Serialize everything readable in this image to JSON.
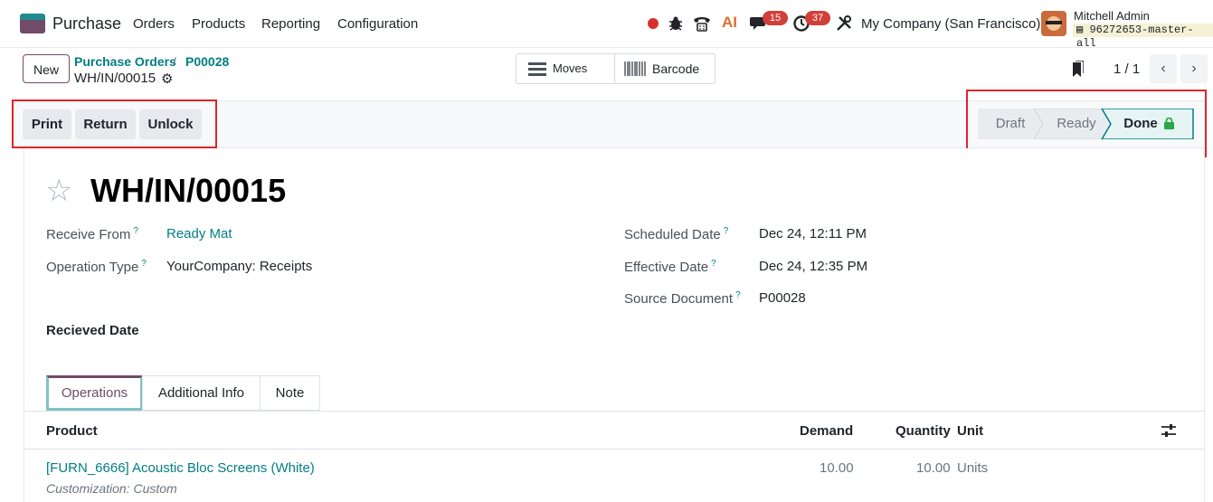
{
  "navbar": {
    "app_name": "Purchase",
    "menus": [
      "Orders",
      "Products",
      "Reporting",
      "Configuration"
    ],
    "chat_badge": "15",
    "activity_badge": "37",
    "ai_label": "AI",
    "company": "My Company (San Francisco)",
    "user_name": "Mitchell Admin",
    "db_name": "96272653-master-all"
  },
  "control": {
    "new_label": "New",
    "breadcrumb": [
      "Purchase Orders",
      "P00028"
    ],
    "breadcrumb_sep": "/",
    "current": "WH/IN/00015",
    "moves_label": "Moves",
    "barcode_label": "Barcode",
    "pager": "1 / 1",
    "prev": "‹",
    "next": "›"
  },
  "actions": {
    "print": "Print",
    "return": "Return",
    "unlock": "Unlock"
  },
  "stages": {
    "draft": "Draft",
    "ready": "Ready",
    "done": "Done",
    "active": "done"
  },
  "record": {
    "title": "WH/IN/00015",
    "left_fields": [
      {
        "label": "Receive From",
        "value": "Ready Mat"
      },
      {
        "label": "Operation Type",
        "value": "YourCompany: Receipts"
      }
    ],
    "right_fields": [
      {
        "label": "Scheduled Date",
        "value": "Dec 24, 12:11 PM"
      },
      {
        "label": "Effective Date",
        "value": "Dec 24, 12:35 PM"
      },
      {
        "label": "Source Document",
        "value": "P00028"
      }
    ],
    "help_mark": "?",
    "received_date_label": "Recieved Date"
  },
  "tabs": [
    "Operations",
    "Additional Info",
    "Note"
  ],
  "table": {
    "headers": {
      "product": "Product",
      "demand": "Demand",
      "quantity": "Quantity",
      "unit": "Unit"
    },
    "rows": [
      {
        "product": "[FURN_6666] Acoustic Bloc Screens (White)",
        "demand": "10.00",
        "quantity": "10.00",
        "unit": "Units",
        "note": "Customization: Custom"
      }
    ]
  },
  "colors": {
    "brand": "#714b67",
    "accent": "#017e84",
    "badge": "#d23f3a",
    "highlight": "#e0242b",
    "done_lock": "#28a745"
  }
}
